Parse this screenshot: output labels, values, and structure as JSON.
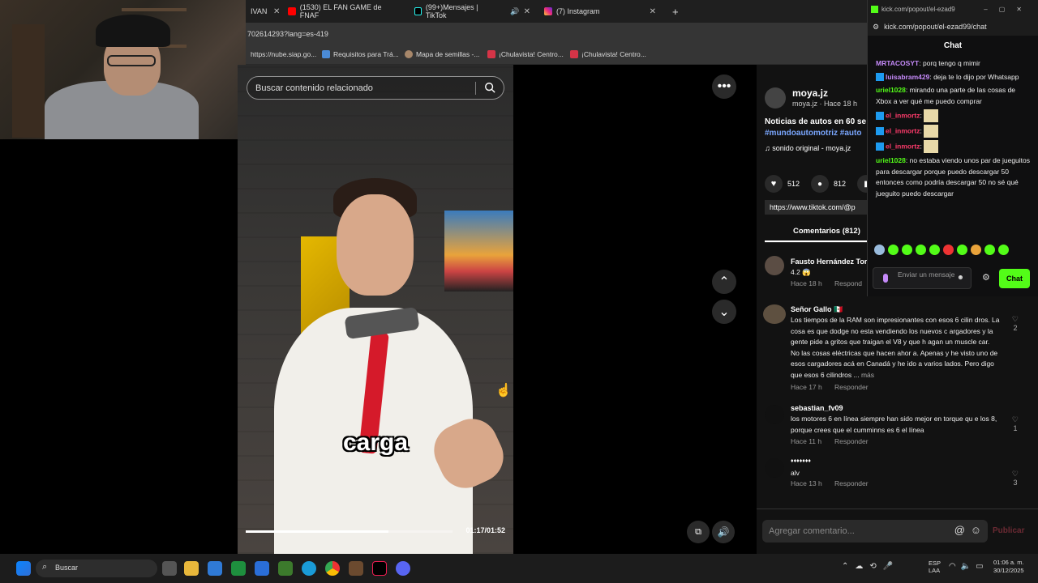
{
  "browser": {
    "tabs": [
      {
        "label": "IVAN",
        "active": false
      },
      {
        "label": "(1530) EL FAN GAME de FNAF",
        "active": false
      },
      {
        "label": "(99+)Mensajes | TikTok",
        "active": true
      },
      {
        "label": "(7) Instagram",
        "active": false
      }
    ],
    "url": "702614293?lang=es-419",
    "bookmarks": [
      "https://nube.siap.go...",
      "Requisitos para Trá...",
      "Mapa de semillas -...",
      "¡Chulavista! Centro...",
      "¡Chulavista! Centro..."
    ]
  },
  "tiktok": {
    "search_placeholder": "Buscar contenido relacionado",
    "caption": "carga",
    "time": "01:17/01:52",
    "progress_fraction": 0.69,
    "author": {
      "username": "moya.jz",
      "handle_time": "moya.jz · Hace 18 h",
      "description": "Noticias de autos en 60 se",
      "hashtags": "#mundoautomotriz #auto",
      "sound": "sonido original - moya.jz"
    },
    "likes": "512",
    "comments_count": "812",
    "link": "https://www.tiktok.com/@p",
    "comments_tab": "Comentarios (812)",
    "comments": [
      {
        "name": "Fausto Hernández Tor",
        "text": "4.2 😱",
        "time": "Hace 18 h",
        "reply": "Respond",
        "likes": ""
      },
      {
        "name": "Señor Gallo 🇲🇽",
        "text": "Los tiempos de la RAM son impresionantes con esos 6 cilin dros. La cosa es que dodge no esta vendiendo los nuevos c argadores y la gente pide a gritos que traigan el V8 y que h agan un muscle car. No las cosas eléctricas que hacen ahor a. Apenas y he visto uno de esos cargadores acá en Canadá y he ido a varios lados. Pero digo que esos 6 cilindros ...",
        "more": "más",
        "time": "Hace 17 h",
        "reply": "Responder",
        "likes": "2"
      },
      {
        "name": "sebastian_fv09",
        "text": "los motores 6 en línea siempre han sido mejor en torque qu e los 8, porque crees que el cumminns es 6 el línea",
        "time": "Hace 11 h",
        "reply": "Responder",
        "likes": "1"
      },
      {
        "name": "♦♦♦♦♦♦♦",
        "text": "alv",
        "time": "Hace 13 h",
        "reply": "Responder",
        "likes": "3"
      }
    ],
    "add_comment_placeholder": "Agregar comentario...",
    "publish": "Publicar"
  },
  "kick": {
    "window_url": "kick.com/popout/el-ezad9",
    "url": "kick.com/popout/el-ezad99/chat",
    "title": "Chat",
    "messages": [
      {
        "name": "MRTACOSYT",
        "color": "#c58af9",
        "badge": false,
        "text": "porq tengo q mimir"
      },
      {
        "name": "luisabram429",
        "color": "#c58af9",
        "badge": true,
        "text": "deja te lo dijo por Whatsapp"
      },
      {
        "name": "uriel1028",
        "color": "#53fc18",
        "badge": false,
        "text": "mirando una parte de las cosas de Xbox a ver qué me puedo comprar"
      },
      {
        "name": "el_inmortz",
        "color": "#ff3b6b",
        "badge": true,
        "text": ""
      },
      {
        "name": "el_inmortz",
        "color": "#ff3b6b",
        "badge": true,
        "text": ""
      },
      {
        "name": "el_inmortz",
        "color": "#ff3b6b",
        "badge": true,
        "text": ""
      },
      {
        "name": "uriel1028",
        "color": "#53fc18",
        "badge": false,
        "text": "no estaba viendo unos par de jueguitos para descargar porque puedo descargar 50 entonces como podría descargar 50 no sé qué jueguito puedo descargar"
      }
    ],
    "input_placeholder": "Enviar un mensaje",
    "chat_button": "Chat"
  },
  "taskbar": {
    "search": "Buscar",
    "lang": "ESP\nLAA",
    "time": "01:06 a. m.",
    "date": "30/12/2025"
  }
}
